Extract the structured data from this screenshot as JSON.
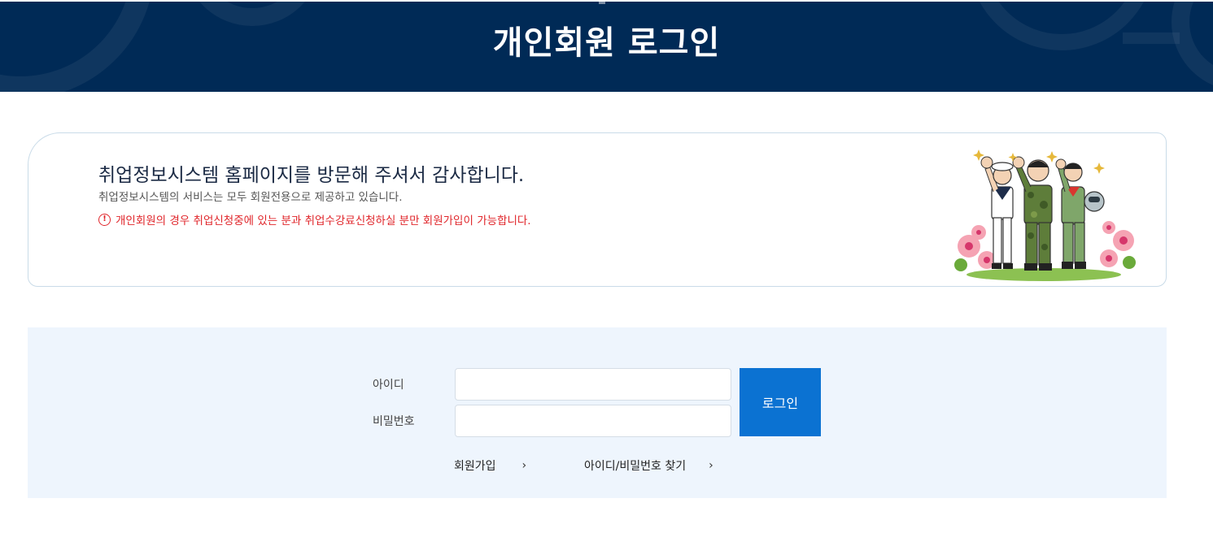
{
  "header": {
    "title": "개인회원 로그인"
  },
  "notice": {
    "title": "취업정보시스템 홈페이지를 방문해 주셔서 감사합니다.",
    "subtitle": "취업정보시스템의 서비스는 모두 회원전용으로 제공하고 있습니다.",
    "warning_icon": "!",
    "warning": "개인회원의 경우 취업신청중에 있는 분과 취업수강료신청하실 분만 회원가입이 가능합니다.",
    "illustration": "soldiers-illustration"
  },
  "login": {
    "id_label": "아이디",
    "id_value": "",
    "pw_label": "비밀번호",
    "pw_value": "",
    "button_label": "로그인"
  },
  "links": {
    "join_label": "회원가입",
    "find_label": "아이디/비밀번호 찾기",
    "chevron_icon": "chevron-right-icon"
  },
  "colors": {
    "header_bg": "#002a56",
    "login_button": "#0b72d2",
    "login_area_bg": "#eef5fd",
    "warning_text": "#e0262b"
  }
}
